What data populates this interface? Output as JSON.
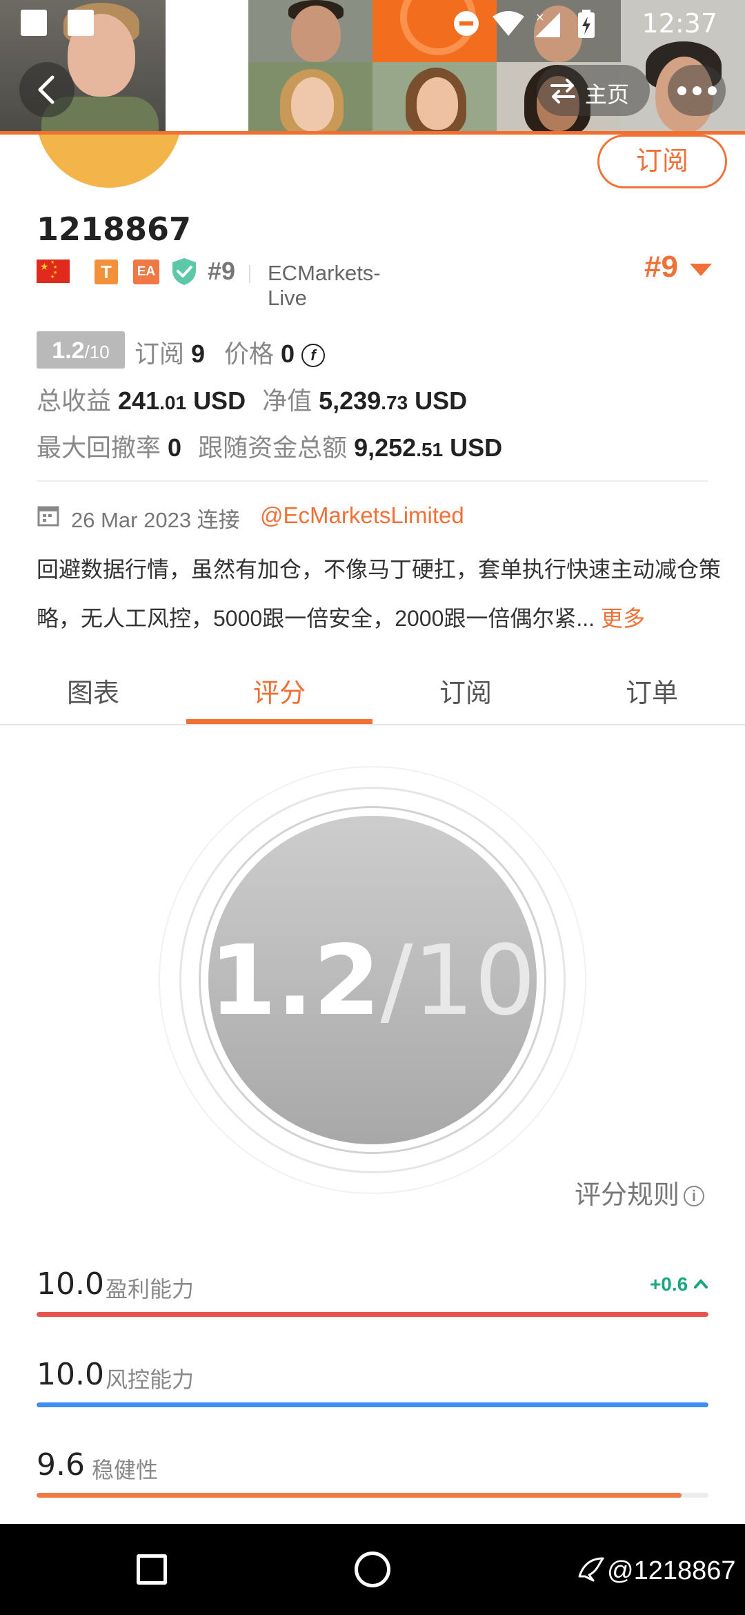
{
  "status_bar": {
    "time": "12:37"
  },
  "top_nav": {
    "home_label": "主页"
  },
  "profile": {
    "subscribe_label": "订阅",
    "username": "1218867",
    "rank_small": "#9",
    "server": "ECMarkets-Live",
    "rank_big": "#9",
    "badges": [
      "china-flag",
      "T",
      "EA",
      "verified-shield"
    ]
  },
  "stats": {
    "score_main": "1.2",
    "score_max": "/10",
    "subs_label": "订阅",
    "subs_value": "9",
    "price_label": "价格",
    "price_value": "0",
    "total_profit_label": "总收益",
    "total_profit_int": "241",
    "total_profit_dec": ".01",
    "total_profit_unit": "USD",
    "equity_label": "净值",
    "equity_int": "5,239",
    "equity_dec": ".73",
    "equity_unit": "USD",
    "drawdown_label": "最大回撤率",
    "drawdown_value": "0",
    "follow_funds_label": "跟随资金总额",
    "follow_funds_int": "9,252",
    "follow_funds_dec": ".51",
    "follow_funds_unit": "USD"
  },
  "about": {
    "date": "26 Mar 2023 连接",
    "handle": "@EcMarketsLimited",
    "description": "回避数据行情，虽然有加仓，不像马丁硬扛，套单执行快速主动减仓策略，无人工风控，5000跟一倍安全，2000跟一倍偶尔紧...",
    "more": "更多"
  },
  "tabs": [
    {
      "label": "图表"
    },
    {
      "label": "评分"
    },
    {
      "label": "订阅"
    },
    {
      "label": "订单"
    }
  ],
  "active_tab": "评分",
  "rating": {
    "score": "1.2",
    "max": "/10",
    "rules_label": "评分规则"
  },
  "metrics": [
    {
      "value": "10.0",
      "label": "盈利能力",
      "fraction": 1.0,
      "color": "#e8534f",
      "delta": "+0.6"
    },
    {
      "value": "10.0",
      "label": "风控能力",
      "fraction": 1.0,
      "color": "#3d8ef0"
    },
    {
      "value": "9.6",
      "label": "稳健性",
      "fraction": 0.96,
      "color": "#f07845"
    }
  ],
  "watermark": "@1218867",
  "colors": {
    "accent": "#f07035",
    "positive": "#1aa683"
  }
}
